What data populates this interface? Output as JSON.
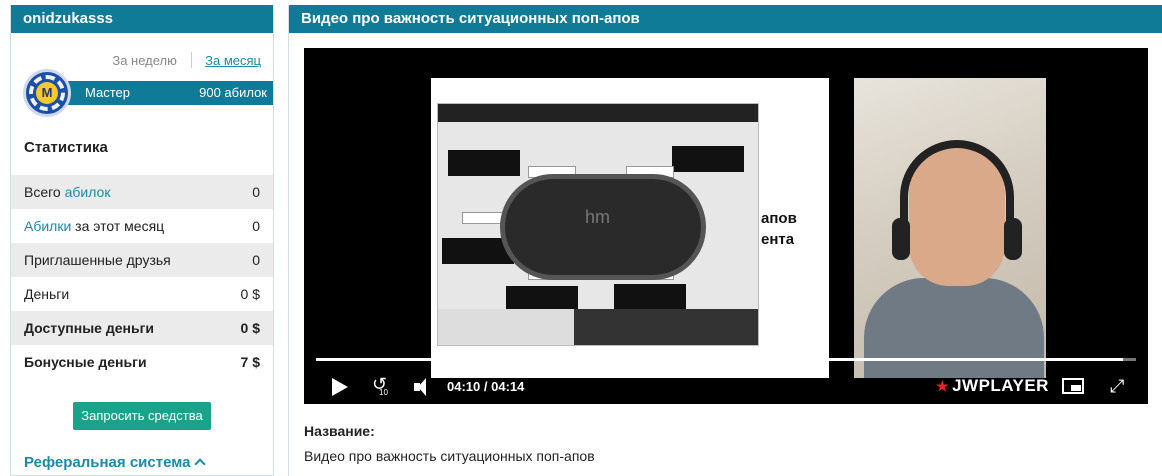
{
  "user": {
    "username": "onidzukasss"
  },
  "period": {
    "week_label": "За неделю",
    "month_label": "За месяц"
  },
  "rank": {
    "chip_letter": "M",
    "title": "Мастер",
    "points": "900 абилок"
  },
  "stats": {
    "title": "Статистика",
    "rows": [
      {
        "prefix": "Всего ",
        "link": "абилок",
        "suffix": "",
        "value": "0"
      },
      {
        "prefix": "",
        "link": "Абилки",
        "suffix": " за этот месяц",
        "value": "0"
      },
      {
        "prefix": "Приглашенные друзья",
        "link": "",
        "suffix": "",
        "value": "0"
      },
      {
        "prefix": "Деньги",
        "link": "",
        "suffix": "",
        "value": "0 $"
      },
      {
        "prefix": "Доступные деньги",
        "link": "",
        "suffix": "",
        "value": "0 $"
      },
      {
        "prefix": "Бонусные деньги",
        "link": "",
        "suffix": "",
        "value": "7 $"
      }
    ]
  },
  "actions": {
    "request_funds": "Запросить средства"
  },
  "referral": {
    "title": "Реферальная система"
  },
  "video": {
    "header_title": "Видео про важность ситуационных поп-апов",
    "slide_text_line1": "апов",
    "slide_text_line2": "ента",
    "table_logo": "hm",
    "current_time": "04:10",
    "duration": "04:14",
    "time_separator": "/",
    "progress_fraction": 0.984,
    "rewind_seconds": "10",
    "brand": "JWPLAYER",
    "name_label": "Название:",
    "name_value": "Видео про важность ситуационных поп-апов"
  },
  "colors": {
    "header_bg": "#0f7b96",
    "link": "#1a8aa6",
    "button_bg": "#1aa38a",
    "row_shade": "#ebebeb",
    "brand_accent": "#e81f2c"
  }
}
